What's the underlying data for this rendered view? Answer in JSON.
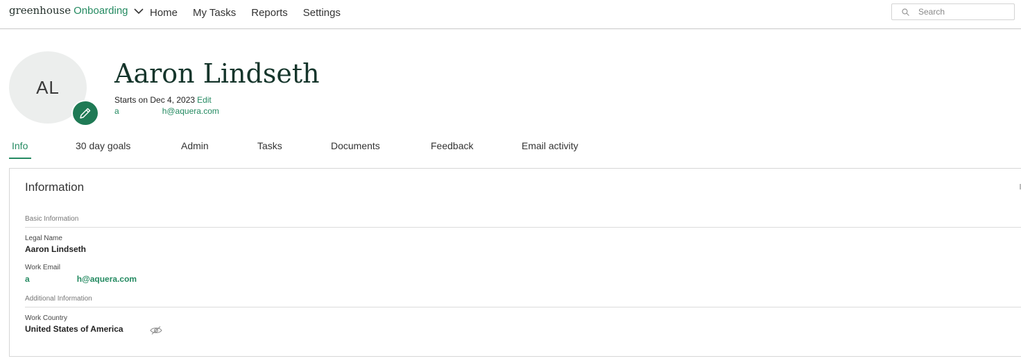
{
  "app": {
    "brand_main": "greenhouse",
    "brand_sub": "Onboarding"
  },
  "nav": [
    {
      "label": "Home"
    },
    {
      "label": "My Tasks"
    },
    {
      "label": "Reports"
    },
    {
      "label": "Settings"
    }
  ],
  "search": {
    "placeholder": "Search"
  },
  "profile": {
    "initials": "AL",
    "name": "Aaron Lindseth",
    "starts_text": "Starts on Dec 4, 2023",
    "edit_label": "Edit",
    "email_part1": "a",
    "email_part2": "h@aquera.com"
  },
  "tabs": [
    {
      "label": "Info",
      "active": true
    },
    {
      "label": "30 day goals"
    },
    {
      "label": "Admin"
    },
    {
      "label": "Tasks"
    },
    {
      "label": "Documents"
    },
    {
      "label": "Feedback"
    },
    {
      "label": "Email activity"
    }
  ],
  "info": {
    "title": "Information",
    "basic_section": "Basic Information",
    "legal_name_label": "Legal Name",
    "legal_name_value": "Aaron Lindseth",
    "work_email_label": "Work Email",
    "work_email_part1": "a",
    "work_email_part2": "h@aquera.com",
    "additional_section": "Additional Information",
    "work_country_label": "Work Country",
    "work_country_value": "United States of America"
  },
  "colors": {
    "accent": "#248a61",
    "edit_avatar_bg": "#1f7a55",
    "name_color": "#15352b"
  },
  "icons": {
    "brand_dropdown": "chevron-down-icon",
    "search": "search-icon",
    "avatar_edit": "pencil-icon",
    "visibility": "eye-slash-icon"
  }
}
